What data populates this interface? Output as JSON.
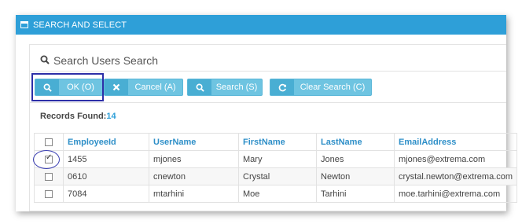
{
  "window": {
    "title": "SEARCH AND SELECT",
    "icon": "window-icon"
  },
  "search": {
    "header": "Search Users Search",
    "icon": "search-icon"
  },
  "buttons": [
    {
      "label": "OK (O)",
      "icon": "search-icon"
    },
    {
      "label": "Cancel (A)",
      "icon": "close-icon"
    },
    {
      "label": "Search (S)",
      "icon": "search-icon"
    },
    {
      "label": "Clear Search (C)",
      "icon": "refresh-icon"
    }
  ],
  "records": {
    "label": "Records Found:",
    "count": "14"
  },
  "table": {
    "columns": [
      "EmployeeId",
      "UserName",
      "FirstName",
      "LastName",
      "EmailAddress"
    ],
    "rows": [
      {
        "checked": true,
        "cells": [
          "1455",
          "mjones",
          "Mary",
          "Jones",
          "mjones@extrema.com"
        ]
      },
      {
        "checked": false,
        "cells": [
          "0610",
          "cnewton",
          "Crystal",
          "Newton",
          "crystal.newton@extrema.com"
        ]
      },
      {
        "checked": false,
        "cells": [
          "7084",
          "mtarhini",
          "Moe",
          "Tarhini",
          "moe.tarhini@extrema.com"
        ]
      }
    ]
  },
  "colors": {
    "accent": "#2e9fd8",
    "button": "#6ec4e1",
    "button_icon": "#49aed3",
    "highlight": "#2d2fa8"
  }
}
